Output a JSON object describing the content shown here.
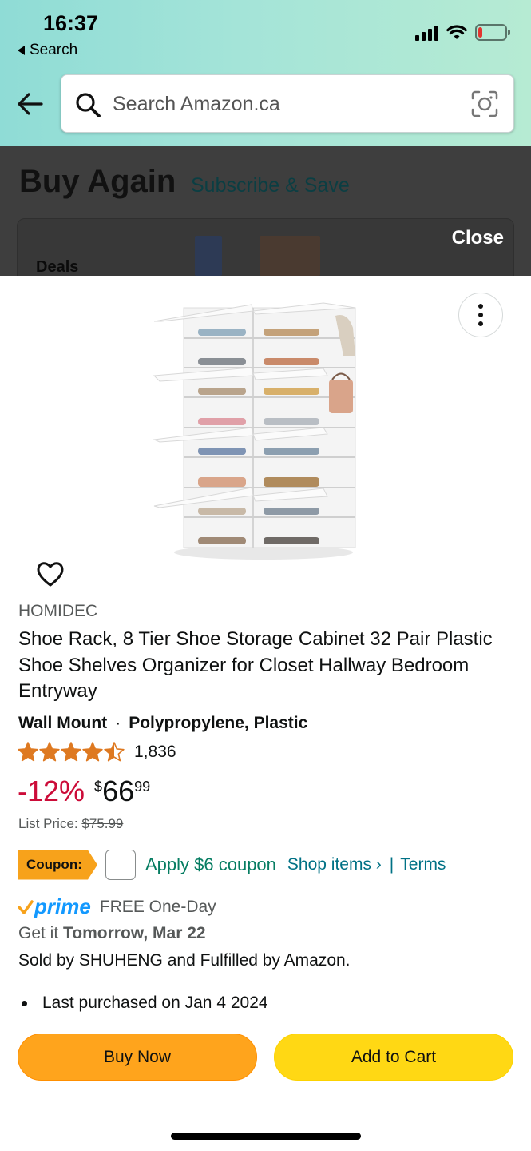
{
  "status_bar": {
    "time": "16:37",
    "back_app": "Search",
    "battery_color": "#e3342f",
    "battery_level": 0.15
  },
  "header": {
    "back_icon": "arrow-left-icon",
    "search_placeholder": "Search Amazon.ca",
    "camera_icon": "camera-lens-icon"
  },
  "background_page": {
    "title": "Buy Again",
    "subscribe_link": "Subscribe & Save",
    "deals_label": "Deals",
    "close_label": "Close"
  },
  "product": {
    "brand": "HOMIDEC",
    "title": "Shoe Rack, 8 Tier Shoe Storage Cabinet 32 Pair Plastic Shoe Shelves Organizer for Closet Hallway Bedroom Entryway",
    "variant_1": "Wall Mount",
    "variant_separator": "·",
    "variant_2": "Polypropylene, Plastic",
    "rating_stars": 4.5,
    "rating_count": "1,836",
    "discount": "-12%",
    "price_currency": "$",
    "price_whole": "66",
    "price_fraction": "99",
    "list_price_label": "List Price:",
    "list_price": "$75.99",
    "coupon": {
      "tag": "Coupon:",
      "apply": "Apply $6 coupon",
      "shop_items": "Shop items ›",
      "separator": "|",
      "terms": "Terms"
    },
    "prime_label": "prime",
    "delivery_type": "FREE One-Day",
    "get_it_prefix": "Get it",
    "get_it_date": "Tomorrow, Mar 22",
    "sold_by": "Sold by SHUHENG and Fulfilled by Amazon.",
    "last_purchased": "Last purchased on Jan 4 2024"
  },
  "actions": {
    "buy_now": "Buy Now",
    "add_to_cart": "Add to Cart"
  },
  "colors": {
    "discount": "#cc0c39",
    "link": "#007185",
    "coupon_green": "#067d62",
    "coupon_tag": "#f7a21b",
    "prime_blue": "#1399ff",
    "buy_now": "#ffa41c",
    "add_to_cart": "#ffd814",
    "star": "#de7921"
  }
}
